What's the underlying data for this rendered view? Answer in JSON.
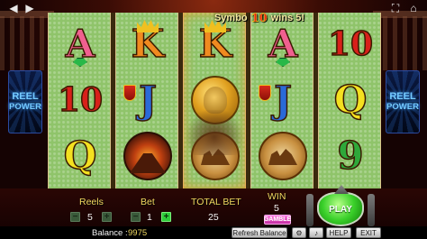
{
  "top_message": {
    "prefix": "Symbo",
    "ten": "10",
    "suffix": "wins 5!"
  },
  "nav_icons": {
    "back": "arrow-left-icon",
    "forward": "arrow-right-icon",
    "fullscreen": "fullscreen-icon",
    "home": "home-icon"
  },
  "power_badges": {
    "line1": "REEL",
    "line2": "POWER"
  },
  "reels": [
    [
      "A",
      "10",
      "Q"
    ],
    [
      "K",
      "J",
      "volcano"
    ],
    [
      "K",
      "coin",
      "chariot"
    ],
    [
      "A",
      "J",
      "chariot"
    ],
    [
      "10",
      "Q",
      "9"
    ]
  ],
  "controls": {
    "reels_label": "Reels",
    "reels_value": "5",
    "bet_label": "Bet",
    "bet_value": "1",
    "total_bet_label": "TOTAL BET",
    "total_bet_value": "25",
    "win_label": "WIN",
    "win_value": "5",
    "gamble_label": "GAMBLE",
    "play_label": "PLAY",
    "minus_symbol": "−",
    "plus_symbol": "+"
  },
  "footer": {
    "balance_label": "Balance :",
    "balance_value": "9975",
    "refresh_label": "Refresh Balance",
    "settings_symbol": "⚙",
    "sound_symbol": "♪",
    "help_label": "HELP",
    "exit_label": "EXIT"
  },
  "colors": {
    "felt": "#8fc46a",
    "panel": "#2a0604",
    "accent_gold": "#f0d860",
    "play_green": "#3ad02a"
  }
}
